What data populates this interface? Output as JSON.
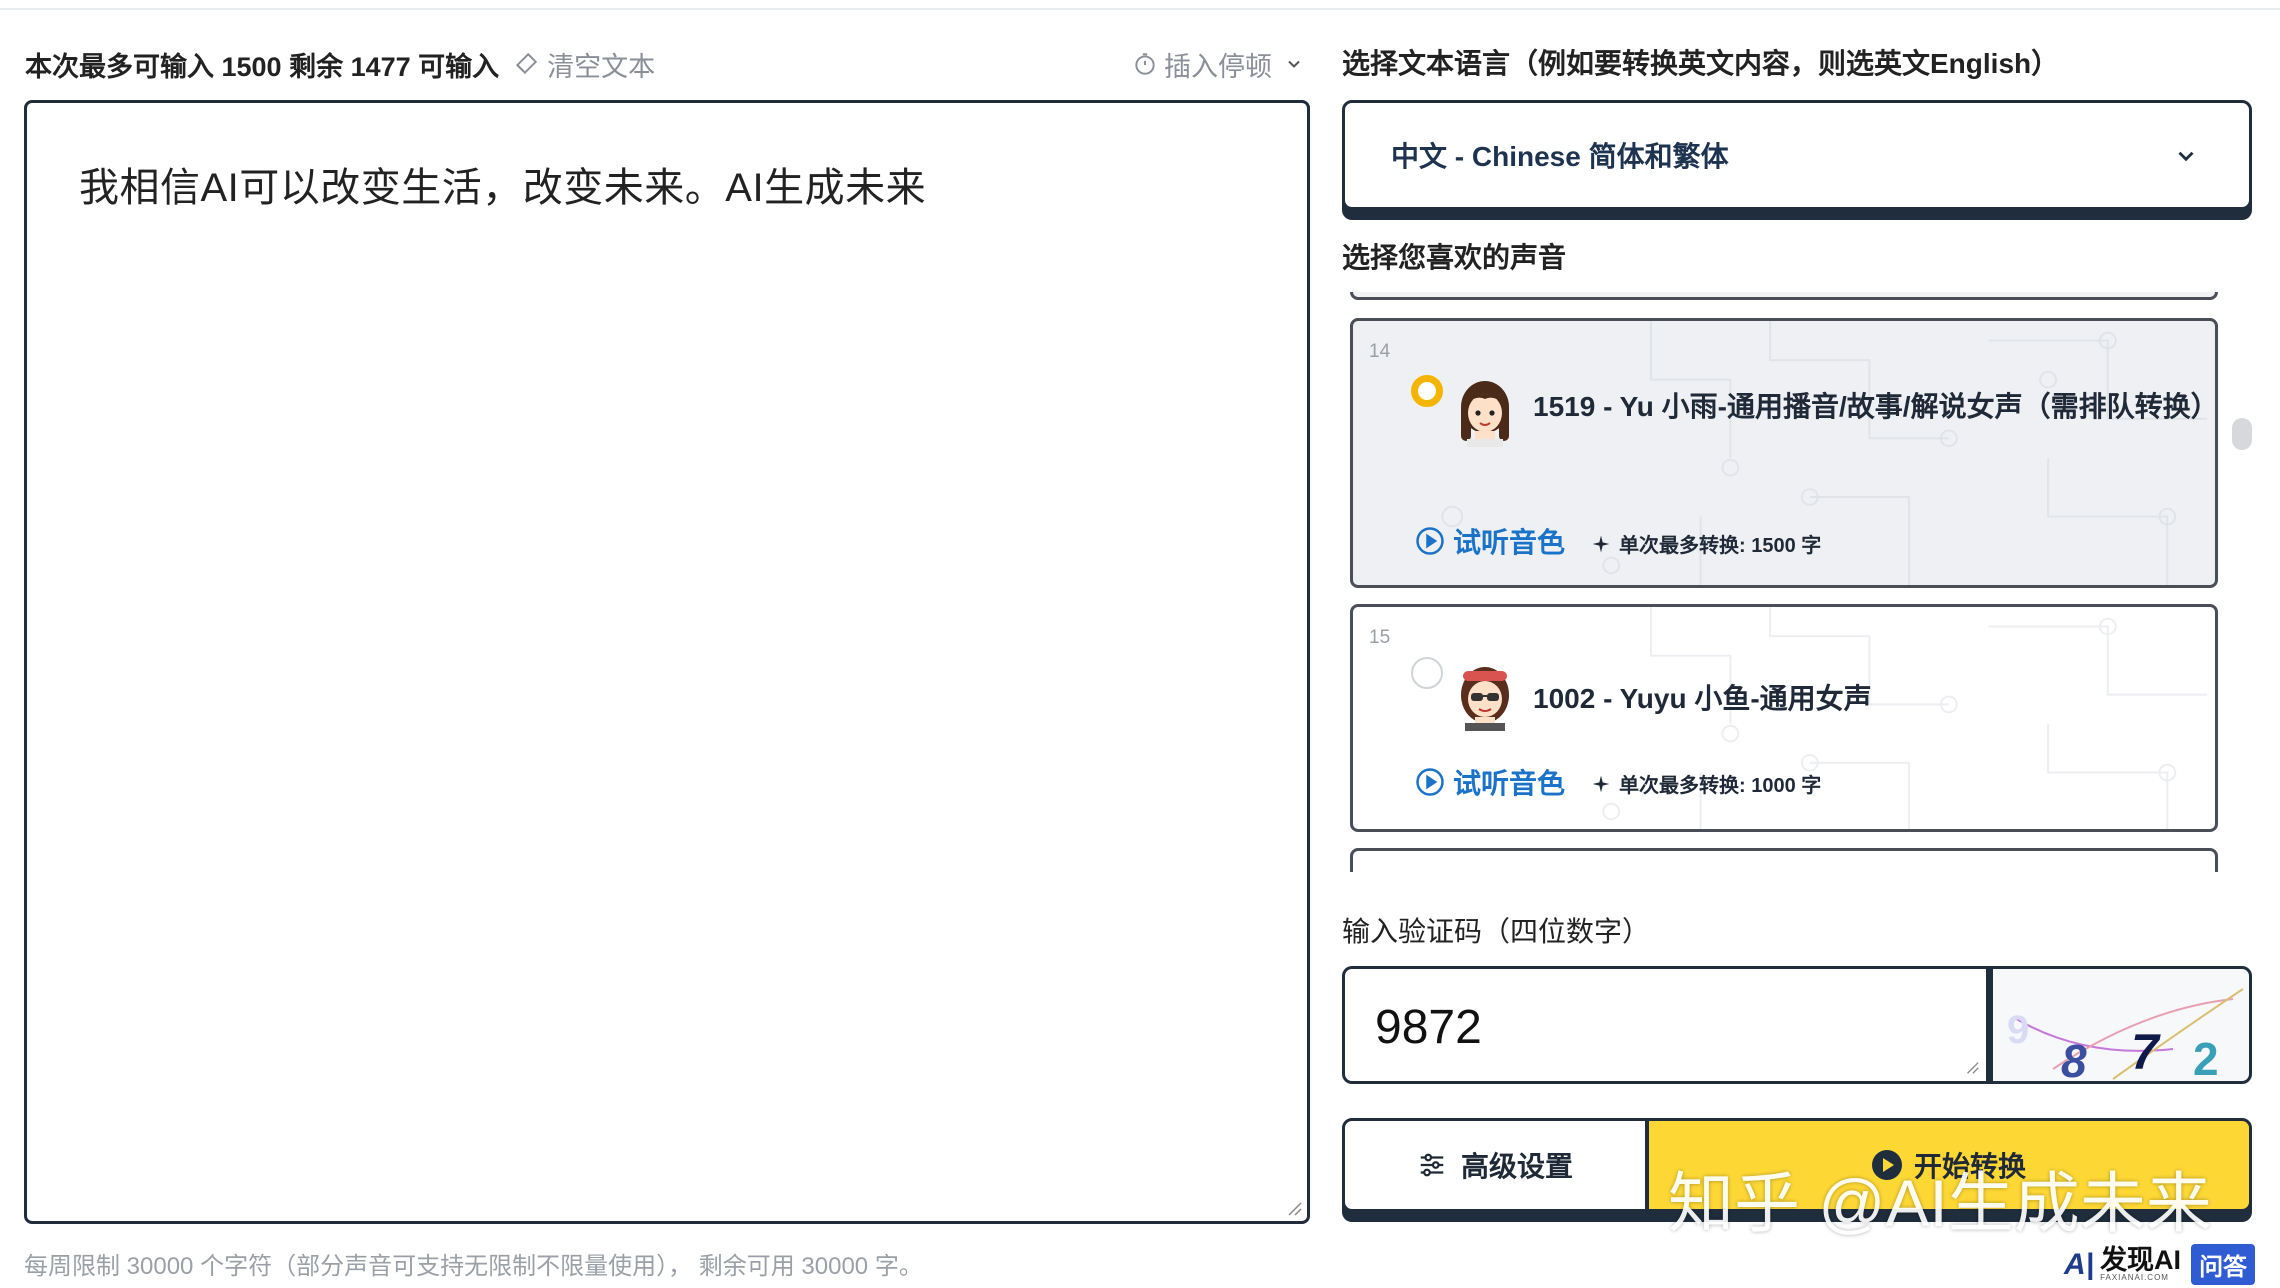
{
  "left": {
    "limit_text": "本次最多可输入 1500 剩余 1477 可输入",
    "clear_label": "清空文本",
    "pause_label": "插入停顿",
    "text_value": "我相信AI可以改变生活，改变未来。AI生成未来",
    "footer_note": "每周限制 30000 个字符（部分声音可支持无限制不限量使用）， 剩余可用 30000 字。"
  },
  "right": {
    "lang_label": "选择文本语言（例如要转换英文内容，则选英文English）",
    "lang_value": "中文 - Chinese 简体和繁体",
    "voice_label": "选择您喜欢的声音",
    "voices": [
      {
        "index": "14",
        "name": "1519 - Yu 小雨-通用播音/故事/解说女声（需排队转换）",
        "preview_label": "试听音色",
        "max_label": "单次最多转换: 1500 字",
        "selected": true
      },
      {
        "index": "15",
        "name": "1002 - Yuyu 小鱼-通用女声",
        "preview_label": "试听音色",
        "max_label": "单次最多转换: 1000 字",
        "selected": false
      }
    ],
    "captcha_label": "输入验证码（四位数字）",
    "captcha_value": "9872",
    "captcha_image_digits": [
      "9",
      "8",
      "7",
      "2"
    ],
    "advanced_label": "高级设置",
    "start_label": "开始转换"
  },
  "overlay": {
    "watermark": "知乎 @AI生成未来",
    "brand_name": "发现AI",
    "brand_sub": "FAXIANAI.COM",
    "brand_qa": "问答"
  },
  "colors": {
    "border_dark": "#1f2d3d",
    "accent_yellow": "#fdd835",
    "link_blue": "#1a73c8",
    "radio_selected": "#f4b400",
    "muted_text": "#8a8f98"
  }
}
